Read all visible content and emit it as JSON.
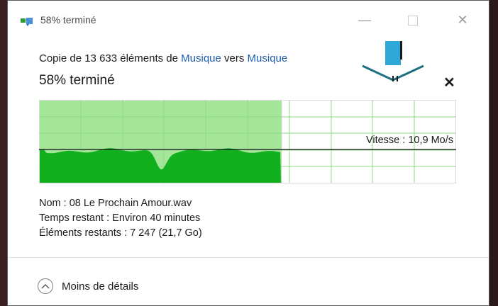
{
  "window": {
    "title": "58% terminé",
    "controls": {
      "minimize": "—",
      "close": "✕"
    }
  },
  "copy": {
    "prefix": "Copie de 13 633 éléments de ",
    "source": "Musique",
    "middle": " vers ",
    "destination": "Musique"
  },
  "progress": {
    "heading": "58% terminé",
    "percent": 58,
    "cancel": "✕"
  },
  "speed": {
    "label": "Vitesse : 10,9 Mo/s"
  },
  "details": {
    "name_label": "Nom : ",
    "name_value": "08 Le Prochain Amour.wav",
    "time_label": "Temps restant : ",
    "time_value": "Environ 40 minutes",
    "items_label": "Éléments restants : ",
    "items_value": "7 247 (21,7 Go)"
  },
  "footer": {
    "label": "Moins de détails"
  },
  "colors": {
    "accent_link": "#1f5fae",
    "graph_light": "#a6e69a",
    "graph_dark": "#12b01f",
    "grid": "#8fd98a"
  }
}
